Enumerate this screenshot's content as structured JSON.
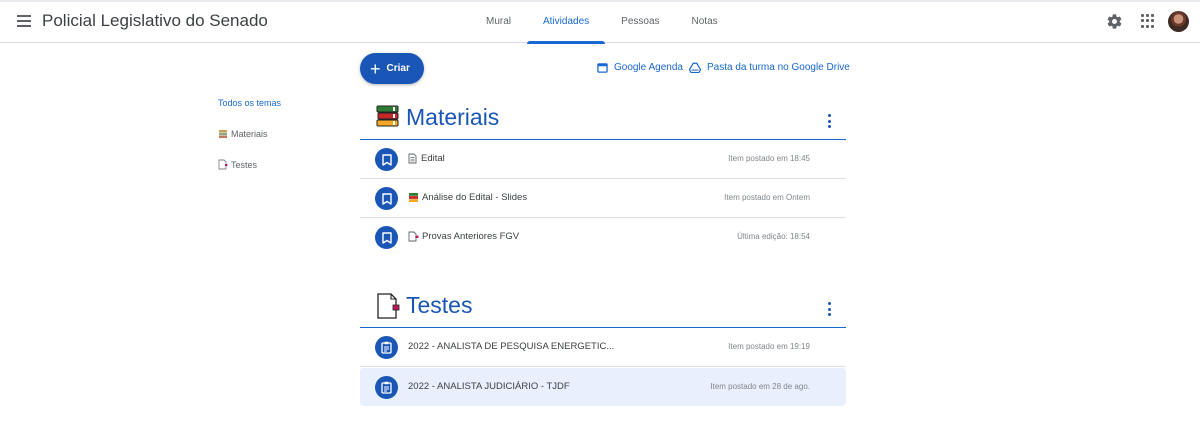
{
  "header": {
    "class_title": "Policial Legislativo do Senado",
    "tabs": [
      {
        "label": "Mural",
        "active": false
      },
      {
        "label": "Atividades",
        "active": true
      },
      {
        "label": "Pessoas",
        "active": false
      },
      {
        "label": "Notas",
        "active": false
      }
    ],
    "icons": [
      "menu-icon",
      "settings-icon",
      "apps-icon",
      "avatar"
    ]
  },
  "toolbar": {
    "create_label": "Criar",
    "calendar_link": "Google Agenda",
    "drive_link": "Pasta da turma no Google Drive"
  },
  "sidenav": {
    "all_topics": "Todos os temas",
    "items": [
      {
        "label": "Materiais",
        "icon": "books-icon"
      },
      {
        "label": "Testes",
        "icon": "test-page-icon"
      }
    ]
  },
  "topics": [
    {
      "title": "Materiais",
      "icon": "books-icon",
      "items": [
        {
          "title": "Edital",
          "icon": "page-icon",
          "meta": "Item postado em 18:45"
        },
        {
          "title": "Análise do Edital - Slides",
          "icon": "books-icon",
          "meta": "Item postado em Ontem"
        },
        {
          "title": "Provas Anteriores FGV",
          "icon": "test-page-icon",
          "meta": "Última edição: 18:54"
        }
      ]
    },
    {
      "title": "Testes",
      "icon": "test-page-icon",
      "items": [
        {
          "title": "2022 - ANALISTA DE PESQUISA ENERGETIC...",
          "meta": "Item postado em 19:19"
        },
        {
          "title": "2022 - ANALISTA JUDICIÁRIO - TJDF",
          "meta": "Item postado em 28 de ago."
        }
      ]
    }
  ],
  "colors": {
    "accent": "#1967d2",
    "primary_dark": "#1a56b6",
    "row_highlight": "#e8f0fe"
  }
}
